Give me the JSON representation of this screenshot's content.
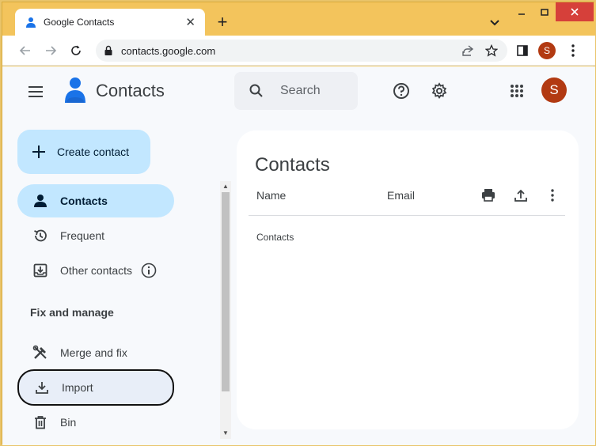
{
  "browser": {
    "tab_title": "Google Contacts",
    "tab_close": "✕",
    "new_tab": "+",
    "url": "contacts.google.com",
    "profile_initial": "S"
  },
  "app": {
    "title": "Contacts",
    "search_placeholder": "Search",
    "avatar_initial": "S"
  },
  "sidebar": {
    "create_label": "Create contact",
    "items": [
      {
        "label": "Contacts",
        "icon": "person-icon",
        "active": true
      },
      {
        "label": "Frequent",
        "icon": "history-icon"
      },
      {
        "label": "Other contacts",
        "icon": "inbox-download-icon"
      }
    ],
    "section_title": "Fix and manage",
    "manage_items": [
      {
        "label": "Merge and fix",
        "icon": "tools-icon"
      },
      {
        "label": "Import",
        "icon": "download-icon",
        "outlined": true
      },
      {
        "label": "Bin",
        "icon": "trash-icon"
      }
    ]
  },
  "main": {
    "title": "Contacts",
    "columns": [
      "Name",
      "Email"
    ],
    "row_label": "Contacts"
  },
  "colors": {
    "accent": "#c2e7ff",
    "avatar": "#b23a12",
    "close_button": "#d6403a",
    "frame": "#f3c45c"
  }
}
